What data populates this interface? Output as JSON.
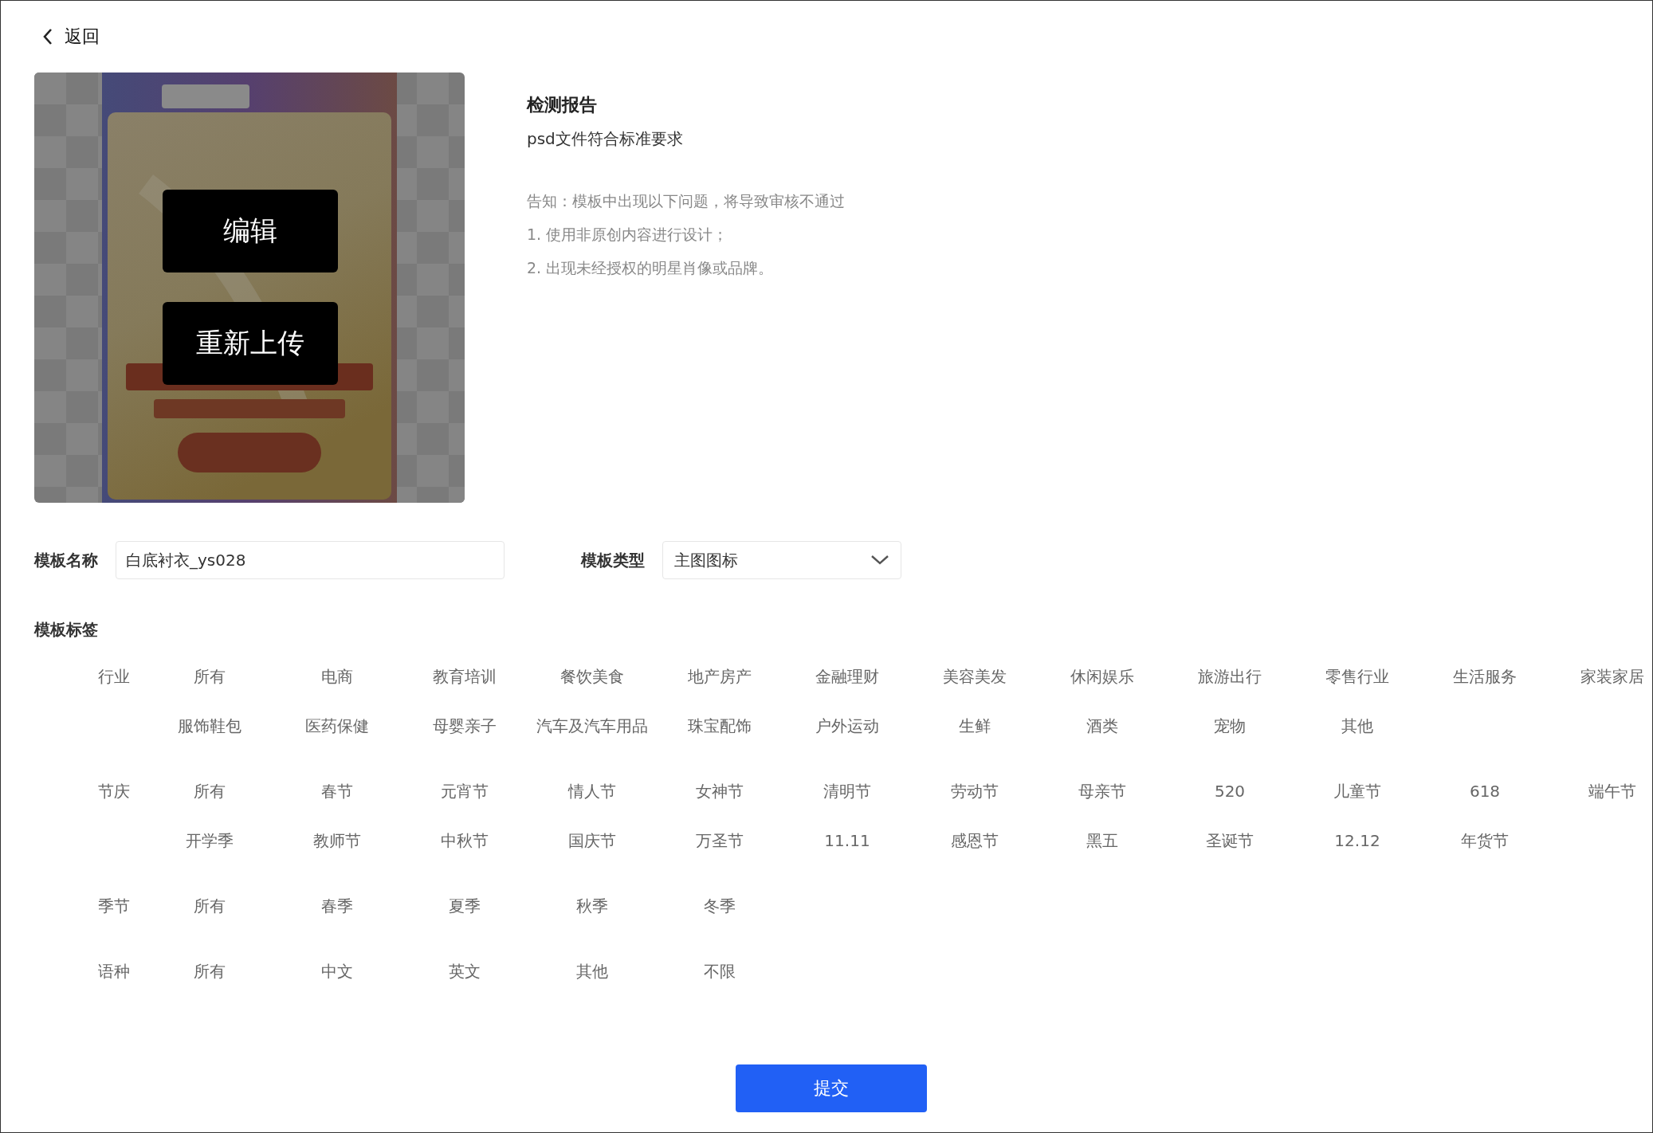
{
  "back": {
    "label": "返回"
  },
  "preview": {
    "kind": "picture",
    "actions": [
      "编辑",
      "重新上传"
    ]
  },
  "report": {
    "title": "检测报告",
    "result": "psd文件符合标准要求",
    "notice": "告知：模板中出现以下问题，将导致审核不通过",
    "rules": [
      "1. 使用非原创内容进行设计；",
      "2. 出现未经授权的明星肖像或品牌。"
    ]
  },
  "form": {
    "name": {
      "label": "模板名称",
      "value": "白底衬衣_ys028"
    },
    "type": {
      "label": "模板类型",
      "value": "主图图标"
    }
  },
  "tags": {
    "title": "模板标签",
    "groups": [
      {
        "label": "行业",
        "items": [
          {
            "text": "所有",
            "selected": false
          },
          {
            "text": "电商",
            "selected": false
          },
          {
            "text": "教育培训",
            "selected": false
          },
          {
            "text": "餐饮美食",
            "selected": false
          },
          {
            "text": "地产房产",
            "selected": false
          },
          {
            "text": "金融理财",
            "selected": false
          },
          {
            "text": "美容美发",
            "selected": false
          },
          {
            "text": "休闲娱乐",
            "selected": false
          },
          {
            "text": "旅游出行",
            "selected": false
          },
          {
            "text": "零售行业",
            "selected": false
          },
          {
            "text": "生活服务",
            "selected": false
          },
          {
            "text": "家装家居",
            "selected": false
          },
          {
            "text": "服饰鞋包",
            "selected": false
          },
          {
            "text": "医药保健",
            "selected": false
          },
          {
            "text": "母婴亲子",
            "selected": false
          },
          {
            "text": "汽车及汽车用品",
            "selected": false
          },
          {
            "text": "珠宝配饰",
            "selected": false
          },
          {
            "text": "户外运动",
            "selected": false
          },
          {
            "text": "生鲜",
            "selected": false
          },
          {
            "text": "酒类",
            "selected": false
          },
          {
            "text": "宠物",
            "selected": false
          },
          {
            "text": "其他",
            "selected": false
          }
        ]
      },
      {
        "label": "节庆",
        "items": [
          {
            "text": "所有",
            "selected": false
          },
          {
            "text": "春节",
            "selected": false
          },
          {
            "text": "元宵节",
            "selected": false
          },
          {
            "text": "情人节",
            "selected": false
          },
          {
            "text": "女神节",
            "selected": false
          },
          {
            "text": "清明节",
            "selected": false
          },
          {
            "text": "劳动节",
            "selected": false
          },
          {
            "text": "母亲节",
            "selected": false
          },
          {
            "text": "520",
            "selected": false
          },
          {
            "text": "儿童节",
            "selected": false
          },
          {
            "text": "618",
            "selected": false
          },
          {
            "text": "端午节",
            "selected": false
          },
          {
            "text": "开学季",
            "selected": false
          },
          {
            "text": "教师节",
            "selected": false
          },
          {
            "text": "中秋节",
            "selected": false
          },
          {
            "text": "国庆节",
            "selected": false
          },
          {
            "text": "万圣节",
            "selected": false
          },
          {
            "text": "11.11",
            "selected": false
          },
          {
            "text": "感恩节",
            "selected": false
          },
          {
            "text": "黑五",
            "selected": false
          },
          {
            "text": "圣诞节",
            "selected": false
          },
          {
            "text": "12.12",
            "selected": false
          },
          {
            "text": "年货节",
            "selected": false
          }
        ]
      },
      {
        "label": "季节",
        "items": [
          {
            "text": "所有",
            "selected": false
          },
          {
            "text": "春季",
            "selected": false
          },
          {
            "text": "夏季",
            "selected": false
          },
          {
            "text": "秋季",
            "selected": false
          },
          {
            "text": "冬季",
            "selected": false
          }
        ]
      },
      {
        "label": "语种",
        "items": [
          {
            "text": "所有",
            "selected": false
          },
          {
            "text": "中文",
            "selected": false
          },
          {
            "text": "英文",
            "selected": false
          },
          {
            "text": "其他",
            "selected": false
          },
          {
            "text": "不限",
            "selected": false
          }
        ]
      }
    ]
  },
  "submit": {
    "label": "提交"
  }
}
